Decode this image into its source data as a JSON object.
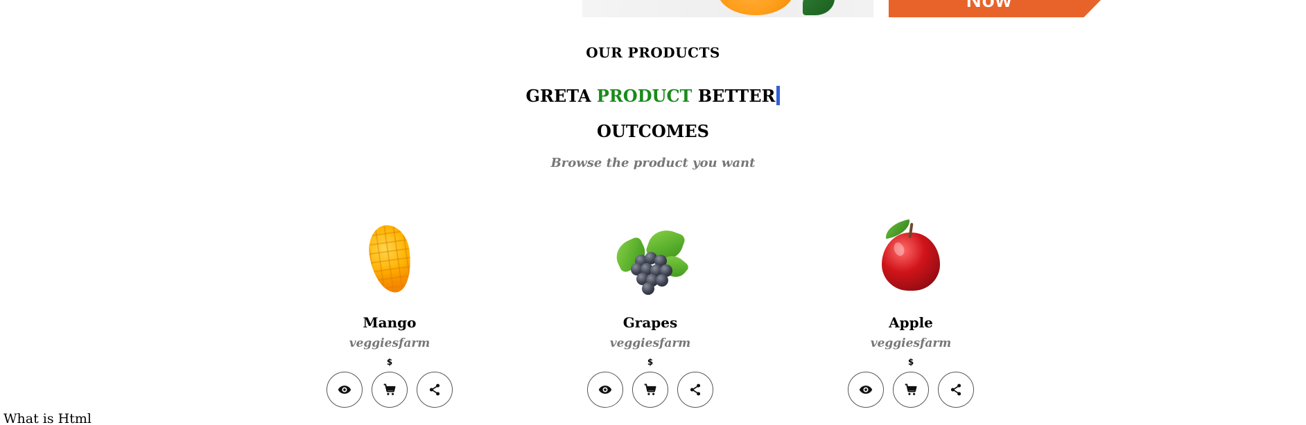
{
  "banner": {
    "cta_label": "Now"
  },
  "section": {
    "eyebrow": "OUR PRODUCTS",
    "title_part1": "GRETA",
    "title_accent": "PRODUCT",
    "title_part2": "BETTER",
    "title_line2": "OUTCOMES",
    "subtitle": "Browse the product you want",
    "accent_color": "#1a8a1a",
    "caret_color": "#2f62d6"
  },
  "products": [
    {
      "name": "Mango",
      "brand": "veggiesfarm",
      "price": "$",
      "image_icon": "mango-icon"
    },
    {
      "name": "Grapes",
      "brand": "veggiesfarm",
      "price": "$",
      "image_icon": "grapes-icon"
    },
    {
      "name": "Apple",
      "brand": "veggiesfarm",
      "price": "$",
      "image_icon": "apple-icon"
    }
  ],
  "actions": [
    {
      "icon": "eye-icon"
    },
    {
      "icon": "cart-icon"
    },
    {
      "icon": "share-icon"
    }
  ],
  "footer": {
    "text": "What is Html"
  }
}
